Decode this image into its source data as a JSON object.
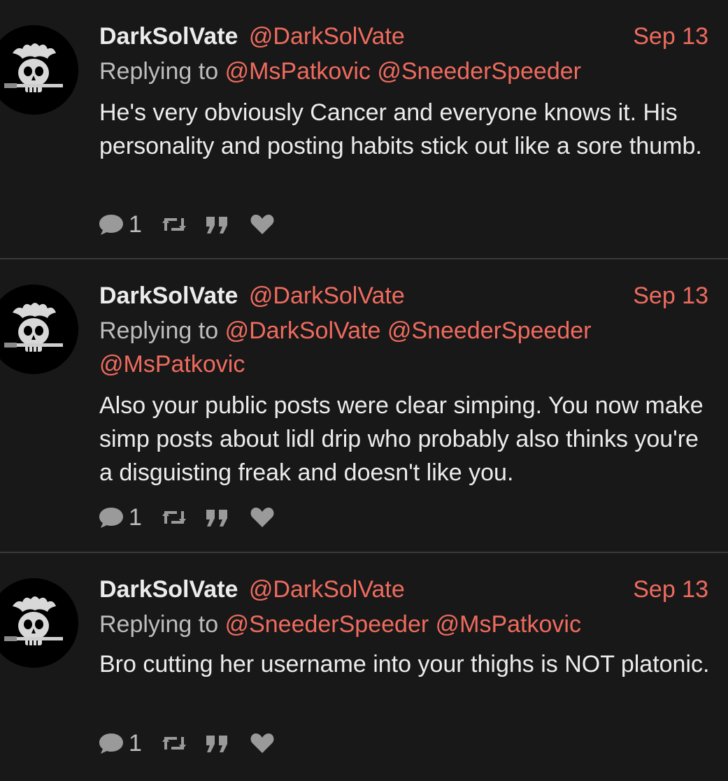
{
  "colors": {
    "background": "#181818",
    "accent": "#ef6b5e",
    "divider": "#3a3a3a",
    "icon": "#9a9a9a"
  },
  "reply_prefix": "Replying to",
  "posts": [
    {
      "author_name": "DarkSolVate",
      "author_handle": "@DarkSolVate",
      "date": "Sep 13",
      "mentions": [
        "@MsPatkovic",
        "@SneederSpeeder"
      ],
      "body": "He's very obviously Cancer and everyone knows it. His personality and posting habits stick out like a sore thumb.",
      "reply_count": "1",
      "icons": [
        "comment-icon",
        "repost-icon",
        "quote-icon",
        "heart-icon"
      ]
    },
    {
      "author_name": "DarkSolVate",
      "author_handle": "@DarkSolVate",
      "date": "Sep 13",
      "mentions": [
        "@DarkSolVate",
        "@SneederSpeeder",
        "@MsPatkovic"
      ],
      "body": "Also your public posts were clear simping. You now make simp posts about lidl drip who probably also thinks you're a disguisting freak and doesn't like you.",
      "reply_count": "1",
      "icons": [
        "comment-icon",
        "repost-icon",
        "quote-icon",
        "heart-icon"
      ]
    },
    {
      "author_name": "DarkSolVate",
      "author_handle": "@DarkSolVate",
      "date": "Sep 13",
      "mentions": [
        "@SneederSpeeder",
        "@MsPatkovic"
      ],
      "body": "Bro cutting her username into your thighs is NOT platonic.",
      "reply_count": "1",
      "icons": [
        "comment-icon",
        "repost-icon",
        "quote-icon",
        "heart-icon"
      ]
    }
  ]
}
